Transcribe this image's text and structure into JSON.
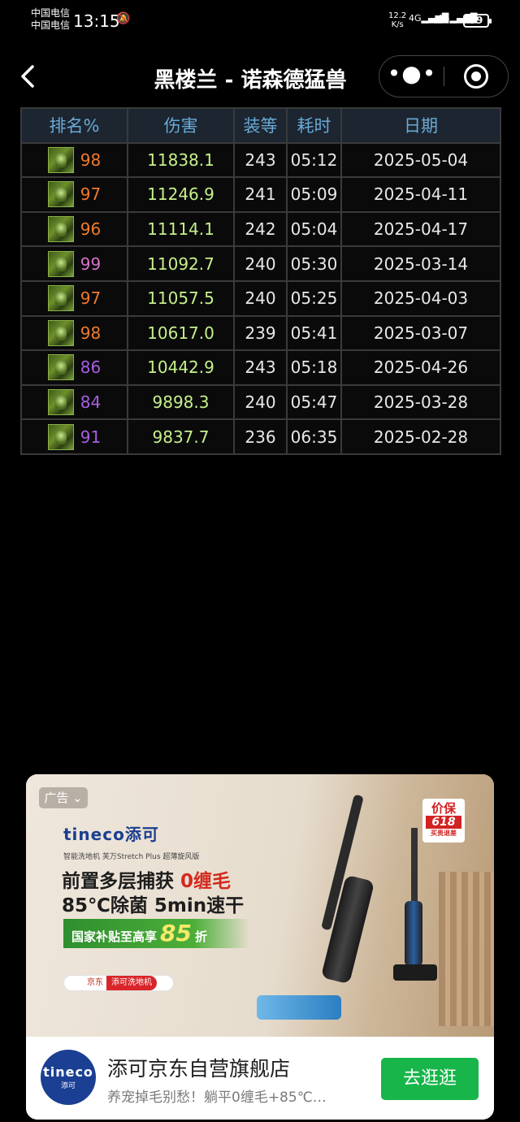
{
  "status": {
    "carrier1": "中国电信",
    "carrier2": "中国电信",
    "time": "13:15",
    "net_speed_value": "12.2",
    "net_speed_unit": "K/s",
    "signal1": "4G",
    "signal2": "4G",
    "battery": "59"
  },
  "nav": {
    "back_icon": "chevron-left-icon",
    "title": "黑楼兰 - 诺森德猛兽",
    "more_icon": "more-dots-icon",
    "close_icon": "miniprogram-close-icon"
  },
  "table": {
    "headers": [
      "排名%",
      "伤害",
      "装等",
      "耗时",
      "日期"
    ],
    "rows": [
      {
        "rank": "98",
        "rank_color": "#f07a2a",
        "damage": "11838.1",
        "ilvl": "243",
        "time": "05:12",
        "date": "2025-05-04"
      },
      {
        "rank": "97",
        "rank_color": "#f07a2a",
        "damage": "11246.9",
        "ilvl": "241",
        "time": "05:09",
        "date": "2025-04-11"
      },
      {
        "rank": "96",
        "rank_color": "#f07a2a",
        "damage": "11114.1",
        "ilvl": "242",
        "time": "05:04",
        "date": "2025-04-17"
      },
      {
        "rank": "99",
        "rank_color": "#d870c8",
        "damage": "11092.7",
        "ilvl": "240",
        "time": "05:30",
        "date": "2025-03-14"
      },
      {
        "rank": "97",
        "rank_color": "#f07a2a",
        "damage": "11057.5",
        "ilvl": "240",
        "time": "05:25",
        "date": "2025-04-03"
      },
      {
        "rank": "98",
        "rank_color": "#f07a2a",
        "damage": "10617.0",
        "ilvl": "239",
        "time": "05:41",
        "date": "2025-03-07"
      },
      {
        "rank": "86",
        "rank_color": "#a65ee0",
        "damage": "10442.9",
        "ilvl": "243",
        "time": "05:18",
        "date": "2025-04-26"
      },
      {
        "rank": "84",
        "rank_color": "#a65ee0",
        "damage": "9898.3",
        "ilvl": "240",
        "time": "05:47",
        "date": "2025-03-28"
      },
      {
        "rank": "91",
        "rank_color": "#a65ee0",
        "damage": "9837.7",
        "ilvl": "236",
        "time": "06:35",
        "date": "2025-02-28"
      }
    ]
  },
  "ad": {
    "tag": "广告",
    "brand": "tineco添可",
    "subline": "智能洗地机 芙万Stretch Plus 超薄旋风版",
    "headline1_a": "前置多层捕获 ",
    "headline1_b": "0缠毛",
    "headline2": "85℃除菌 5min速干",
    "subsidy_pre": "国家补贴至高享",
    "subsidy_num": "85",
    "subsidy_post": "折",
    "jd_label": "京东",
    "jd_tag": "添可洗地机",
    "badge_top": "价保",
    "badge_num": "618",
    "badge_sub": "买贵退差",
    "store_logo_text": "tineco",
    "store_logo_sub": "添可",
    "store_name": "添可京东自营旗舰店",
    "store_sub": "养宠掉毛别愁！躺平0缠毛+85℃…",
    "cta": "去逛逛"
  }
}
